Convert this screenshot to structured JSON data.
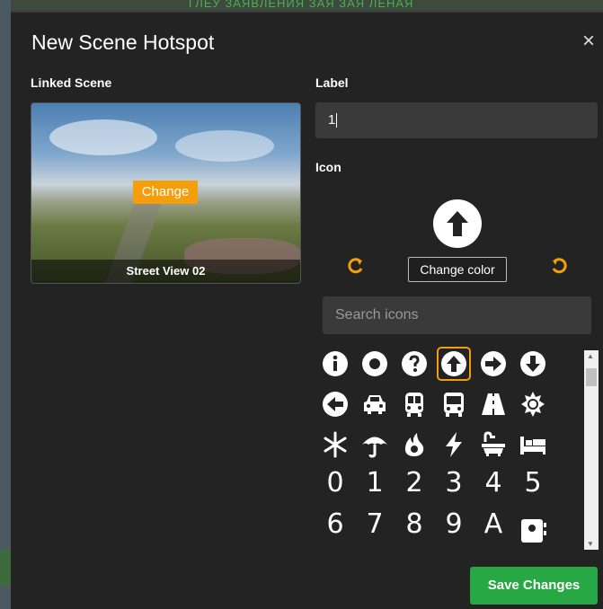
{
  "backdrop": {
    "top_text": "ГЛЕУ ЗАЯВЛЕНИЯ ЗАЯ ЗАЯ ЛЕНАЯ"
  },
  "modal": {
    "title": "New Scene Hotspot",
    "close_symbol": "×"
  },
  "linked_scene": {
    "label": "Linked Scene",
    "change_label": "Change",
    "scene_name": "Street View 02"
  },
  "label_field": {
    "label": "Label",
    "value": "1"
  },
  "icon_section": {
    "label": "Icon",
    "selected_icon": "arrow-up-circle-icon",
    "rotate_cw_icon": "rotate-clockwise-icon",
    "rotate_ccw_icon": "rotate-counterclockwise-icon",
    "change_color_label": "Change color",
    "search_placeholder": "Search icons"
  },
  "icon_grid": {
    "row1": [
      "info-circle-icon",
      "dot-circle-icon",
      "question-circle-icon",
      "arrow-up-circle-icon",
      "arrow-right-circle-icon",
      "arrow-down-circle-icon"
    ],
    "row2": [
      "arrow-left-circle-icon",
      "car-icon",
      "bus-icon",
      "bus-front-icon",
      "road-icon",
      "sun-icon"
    ],
    "row3": [
      "snowflake-icon",
      "umbrella-icon",
      "fire-icon",
      "bolt-icon",
      "bath-icon",
      "bed-icon"
    ],
    "digits": [
      "0",
      "1",
      "2",
      "3",
      "4",
      "5"
    ],
    "partial_row": [
      "6",
      "7",
      "8",
      "9",
      "A",
      "contact-card-icon"
    ]
  },
  "footer": {
    "save_label": "Save Changes"
  },
  "colors": {
    "accent": "#f59e0b",
    "save": "#28a745",
    "panel": "#232323",
    "input": "#3a3a3a"
  }
}
